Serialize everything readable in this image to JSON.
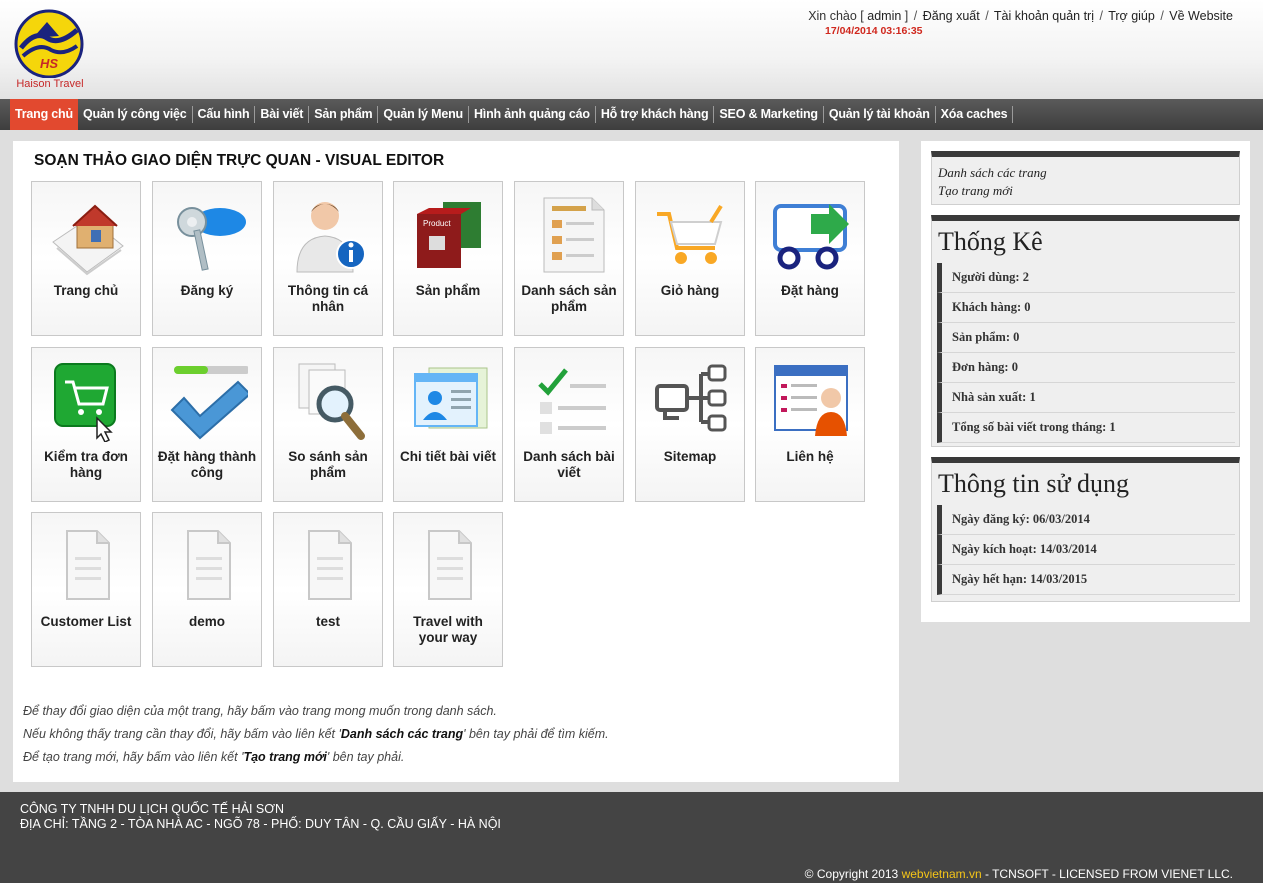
{
  "header": {
    "logo_text": "Haison Travel",
    "logo_letters": "HS",
    "greeting_prefix": "Xin chào [ ",
    "username": "admin",
    "greeting_suffix": " ]",
    "links": [
      "Đăng xuất",
      "Tài khoản quản trị",
      "Trợ giúp",
      "Về Website"
    ],
    "datetime": "17/04/2014 03:16:35"
  },
  "nav": {
    "items": [
      "Trang chủ",
      "Quản lý công việc",
      "Cấu hình",
      "Bài viết",
      "Sản phẩm",
      "Quản lý Menu",
      "Hình ảnh quảng cáo",
      "Hỗ trợ khách hàng",
      "SEO & Marketing",
      "Quản lý tài khoản",
      "Xóa caches"
    ],
    "active_index": 0
  },
  "main": {
    "title": "SOẠN THẢO GIAO DIỆN TRỰC QUAN - VISUAL EDITOR",
    "tiles": [
      {
        "label": "Trang chủ",
        "icon": "home-icon"
      },
      {
        "label": "Đăng ký",
        "icon": "key-icon"
      },
      {
        "label": "Thông tin cá nhân",
        "icon": "user-info-icon"
      },
      {
        "label": "Sản phẩm",
        "icon": "product-box-icon"
      },
      {
        "label": "Danh sách sản phẩm",
        "icon": "product-list-icon"
      },
      {
        "label": "Giỏ hàng",
        "icon": "cart-icon"
      },
      {
        "label": "Đặt hàng",
        "icon": "delivery-truck-icon"
      },
      {
        "label": "Kiểm tra đơn hàng",
        "icon": "order-check-icon"
      },
      {
        "label": "Đặt hàng thành công",
        "icon": "checkmark-icon"
      },
      {
        "label": "So sánh sản phẩm",
        "icon": "magnifier-icon"
      },
      {
        "label": "Chi tiết bài viết",
        "icon": "article-detail-icon"
      },
      {
        "label": "Danh sách bài viết",
        "icon": "checklist-icon"
      },
      {
        "label": "Sitemap",
        "icon": "sitemap-icon"
      },
      {
        "label": "Liên hệ",
        "icon": "contact-icon"
      },
      {
        "label": "Customer List",
        "icon": "document-icon"
      },
      {
        "label": "demo",
        "icon": "document-icon"
      },
      {
        "label": "test",
        "icon": "document-icon"
      },
      {
        "label": "Travel with your way",
        "icon": "document-icon"
      }
    ],
    "help": {
      "line1": "Để thay đổi giao diện của một trang, hãy bấm vào trang mong muốn trong danh sách.",
      "line2_pre": "Nếu không thấy trang cần thay đổi, hãy bấm vào liên kết '",
      "line2_link": "Danh sách các trang",
      "line2_post": "' bên tay phải để tìm kiếm.",
      "line3_pre": "Để tạo trang mới, hãy bấm vào liên kết '",
      "line3_link": "Tạo trang mới",
      "line3_post": "' bên tay phải."
    }
  },
  "sidebar": {
    "links": [
      "Danh sách các trang",
      "Tạo trang mới"
    ],
    "stats_title": "Thống Kê",
    "stats": [
      "Người dùng: 2",
      "Khách hàng: 0",
      "Sản phẩm: 0",
      "Đơn hàng: 0",
      "Nhà sản xuất: 1",
      "Tổng số bài viết trong tháng: 1"
    ],
    "usage_title": "Thông tin sử dụng",
    "usage": [
      "Ngày đăng ký: 06/03/2014",
      "Ngày kích hoạt: 14/03/2014",
      "Ngày hết hạn: 14/03/2015"
    ]
  },
  "footer": {
    "company": "CÔNG TY TNHH DU LỊCH QUỐC TẾ HẢI SƠN",
    "address": "ĐỊA CHỈ: TẦNG 2 - TÒA NHÀ AC - NGÕ 78 - PHỐ: DUY TÂN - Q. CẦU GIẤY - HÀ NỘI",
    "copy_pre": "© Copyright 2013 ",
    "copy_link": "webvietnam.vn",
    "copy_post": " - TCNSOFT - LICENSED FROM VIENET LLC."
  },
  "colors": {
    "accent": "#e2492f",
    "nav_bg": "#4a4a4a",
    "footer_bg": "#444444",
    "datetime": "#d0281e"
  }
}
